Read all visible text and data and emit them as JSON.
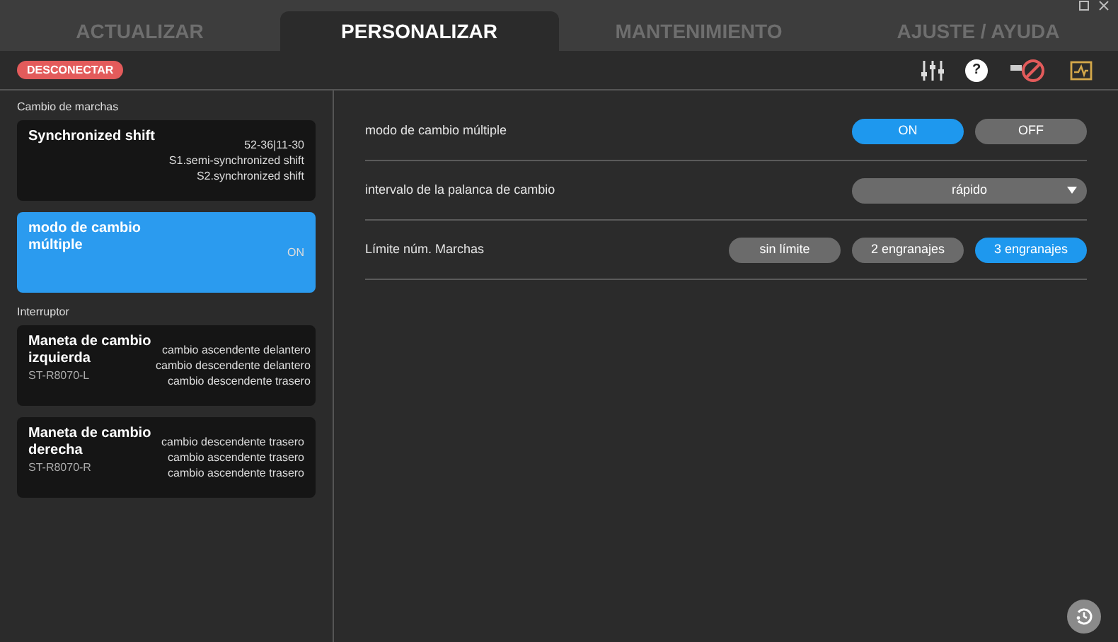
{
  "tabs": [
    {
      "label": "ACTUALIZAR",
      "selected": false
    },
    {
      "label": "PERSONALIZAR",
      "selected": true
    },
    {
      "label": "MANTENIMIENTO",
      "selected": false
    },
    {
      "label": "AJUSTE / AYUDA",
      "selected": false
    }
  ],
  "disconnect_button": "DESCONECTAR",
  "help_icon": "?",
  "sidebar": {
    "sections": [
      {
        "title": "Cambio de marchas",
        "cards": [
          {
            "title": "Synchronized shift",
            "selected": false,
            "lines": [
              "52-36|11-30",
              "S1.semi-synchronized shift",
              "S2.synchronized shift"
            ]
          },
          {
            "title": "modo de cambio múltiple",
            "selected": true,
            "lines": [
              "ON"
            ]
          }
        ]
      },
      {
        "title": "Interruptor",
        "cards": [
          {
            "title": "Maneta de cambio izquierda",
            "subtitle": "ST-R8070-L",
            "selected": false,
            "lines": [
              "cambio ascendente delantero",
              "cambio descendente delantero",
              "cambio descendente trasero"
            ]
          },
          {
            "title": "Maneta de cambio derecha",
            "subtitle": "ST-R8070-R",
            "selected": false,
            "lines": [
              "cambio descendente trasero",
              "cambio ascendente trasero",
              "cambio ascendente trasero"
            ]
          }
        ]
      }
    ]
  },
  "settings": [
    {
      "kind": "choice",
      "label": "modo de cambio múltiple",
      "options": [
        {
          "label": "ON",
          "selected": true
        },
        {
          "label": "OFF",
          "selected": false
        }
      ]
    },
    {
      "kind": "dropdown",
      "label": "intervalo de la palanca de cambio",
      "value": "rápido"
    },
    {
      "kind": "choice",
      "label": "Límite núm. Marchas",
      "options": [
        {
          "label": "sin límite",
          "selected": false
        },
        {
          "label": "2 engranajes",
          "selected": false
        },
        {
          "label": "3 engranajes",
          "selected": true
        }
      ]
    }
  ]
}
